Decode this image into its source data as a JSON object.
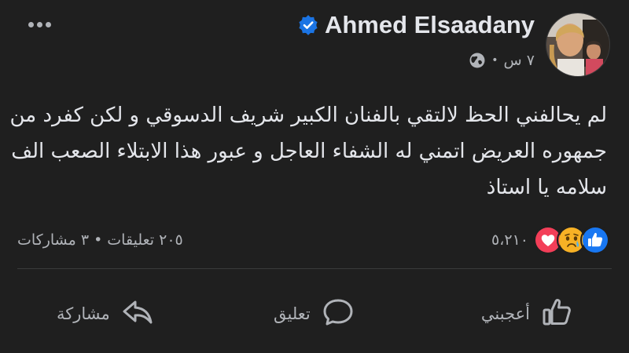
{
  "post": {
    "author_name": "Ahmed Elsaadany",
    "timestamp": "٧ س",
    "separator": "•",
    "privacy_icon": "globe-icon",
    "more_icon": "more-options-icon",
    "text": "لم يحالفني الحظ لالتقي بالفنان الكبير شريف الدسوقي و لكن كفرد من جمهوره العريض اتمني له الشفاء العاجل و عبور هذا الابتلاء الصعب الف سلامه يا استاذ"
  },
  "stats": {
    "reaction_count": "٥،٢١٠",
    "reaction_icons": [
      "like-reaction-icon",
      "sad-reaction-icon",
      "love-reaction-icon"
    ],
    "comments": "٢٠٥ تعليقات",
    "shares": "٣ مشاركات",
    "separator": "•"
  },
  "actions": {
    "like_label": "أعجبني",
    "comment_label": "تعليق",
    "share_label": "مشاركة"
  },
  "colors": {
    "background": "#1f1f1f",
    "text": "#e4e6eb",
    "secondary_text": "#b0b3b8",
    "like_blue": "#1877f2",
    "love_red": "#f33e58",
    "sad_yellow": "#f7b125",
    "verified_blue": "#1b74e4"
  }
}
